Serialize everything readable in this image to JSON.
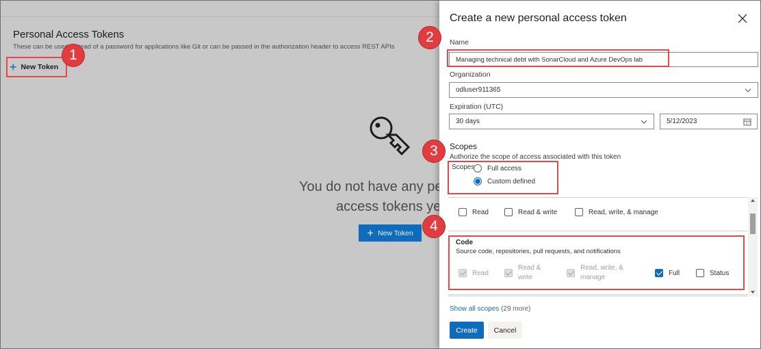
{
  "background": {
    "title": "Personal Access Tokens",
    "description": "These can be used instead of a password for applications like Git or can be passed in the authorization header to access REST APIs",
    "new_token_label": "New Token",
    "empty_line1": "You do not have any pe",
    "empty_line2": "access tokens yet",
    "empty_button_label": "New Token"
  },
  "panel": {
    "title": "Create a new personal access token",
    "name_label": "Name",
    "name_value": "Managing technical debt with SonarCloud and Azure DevOps lab",
    "org_label": "Organization",
    "org_value": "odluser911365",
    "expiration_label": "Expiration (UTC)",
    "expiration_value": "30 days",
    "expiration_date": "5/12/2023",
    "scopes_heading": "Scopes",
    "scopes_desc": "Authorize the scope of access associated with this token",
    "scopes_radio_label": "Scopes",
    "full_access": "Full access",
    "custom_defined": "Custom defined",
    "row1": {
      "read": "Read",
      "read_write": "Read & write",
      "read_write_manage": "Read, write, & manage"
    },
    "code": {
      "title": "Code",
      "desc": "Source code, repositories, pull requests, and notifications",
      "read": "Read",
      "read_write_1": "Read &",
      "read_write_2": "write",
      "rwm_1": "Read, write, &",
      "rwm_2": "manage",
      "full": "Full",
      "status": "Status"
    },
    "show_all": "Show all scopes",
    "show_all_count": "(29 more)",
    "create_label": "Create",
    "cancel_label": "Cancel"
  },
  "badges": [
    "1",
    "2",
    "3",
    "4"
  ],
  "colors": {
    "accent": "#0f6cbd",
    "highlight": "#e8474a",
    "badge": "#e33c40"
  }
}
